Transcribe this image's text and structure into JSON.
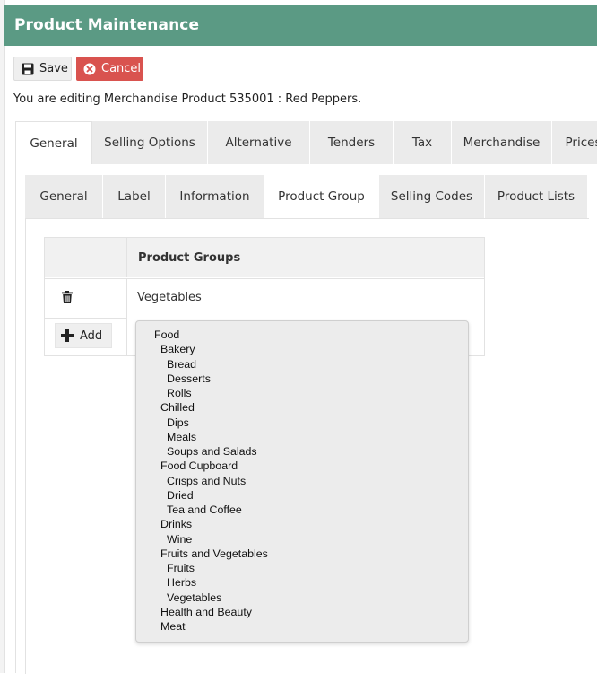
{
  "header": {
    "title": "Product Maintenance"
  },
  "actions": {
    "save_label": "Save",
    "cancel_label": "Cancel"
  },
  "info_text": "You are editing Merchandise Product 535001 : Red Peppers.",
  "main_tabs": [
    {
      "label": "General",
      "active": true
    },
    {
      "label": "Selling Options",
      "active": false
    },
    {
      "label": "Alternative",
      "active": false
    },
    {
      "label": "Tenders",
      "active": false
    },
    {
      "label": "Tax",
      "active": false
    },
    {
      "label": "Merchandise",
      "active": false
    },
    {
      "label": "Prices",
      "active": false
    }
  ],
  "sub_tabs": [
    {
      "label": "General",
      "active": false
    },
    {
      "label": "Label",
      "active": false
    },
    {
      "label": "Information",
      "active": false
    },
    {
      "label": "Product Group",
      "active": true
    },
    {
      "label": "Selling Codes",
      "active": false
    },
    {
      "label": "Product Lists",
      "active": false
    }
  ],
  "product_groups": {
    "column_header": "Product Groups",
    "rows": [
      {
        "value": "Vegetables"
      }
    ],
    "add_label": "Add"
  },
  "group_dropdown": {
    "options": [
      {
        "label": "Food",
        "level": 0
      },
      {
        "label": "Bakery",
        "level": 1
      },
      {
        "label": "Bread",
        "level": 2
      },
      {
        "label": "Desserts",
        "level": 2
      },
      {
        "label": "Rolls",
        "level": 2
      },
      {
        "label": "Chilled",
        "level": 1
      },
      {
        "label": "Dips",
        "level": 2
      },
      {
        "label": "Meals",
        "level": 2
      },
      {
        "label": "Soups and Salads",
        "level": 2
      },
      {
        "label": "Food Cupboard",
        "level": 1
      },
      {
        "label": "Crisps and Nuts",
        "level": 2
      },
      {
        "label": "Dried",
        "level": 2
      },
      {
        "label": "Tea and Coffee",
        "level": 2
      },
      {
        "label": "Drinks",
        "level": 1
      },
      {
        "label": "Wine",
        "level": 2
      },
      {
        "label": "Fruits and Vegetables",
        "level": 1
      },
      {
        "label": "Fruits",
        "level": 2
      },
      {
        "label": "Herbs",
        "level": 2
      },
      {
        "label": "Vegetables",
        "level": 2
      },
      {
        "label": "Health and Beauty",
        "level": 1
      },
      {
        "label": "Meat",
        "level": 1
      }
    ]
  },
  "colors": {
    "header_bg": "#5b9a84",
    "cancel_bg": "#d9534f",
    "tab_bg": "#ebebeb"
  }
}
